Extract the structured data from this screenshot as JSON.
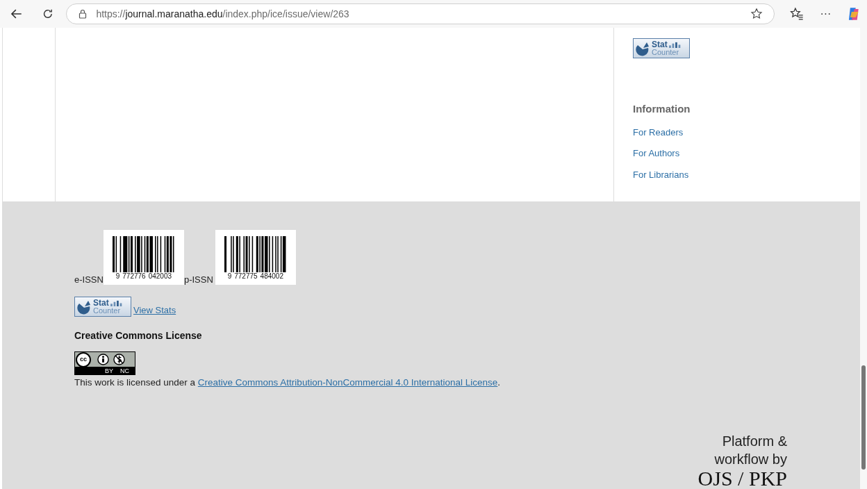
{
  "browser": {
    "url_prefix": "https://",
    "url_host": "journal.maranatha.edu",
    "url_path": "/index.php/ice/issue/view/263",
    "more_label": "···"
  },
  "sidebar": {
    "stat_logo": {
      "line1": "Stat",
      "line2": "Counter"
    },
    "information": {
      "title": "Information",
      "links": [
        "For Readers",
        "For Authors",
        "For Librarians"
      ]
    }
  },
  "footer": {
    "issn": [
      {
        "label": "e-ISSN",
        "digits": [
          "9",
          "772776",
          "042003"
        ]
      },
      {
        "label": "p-ISSN",
        "digits": [
          "9",
          "772775",
          "484002"
        ]
      }
    ],
    "stat_logo": {
      "line1": "Stat",
      "line2": "Counter"
    },
    "view_stats": "View Stats",
    "license_title": "Creative Commons License",
    "cc_badge": {
      "mark": "cc",
      "left": "BY",
      "right": "NC"
    },
    "license_text": "This work is licensed under a ",
    "license_link": "Creative Commons Attribution-NonCommercial 4.0 International License",
    "license_end": ".",
    "platform": {
      "line1": "Platform &",
      "line2": "workflow by",
      "brand": "OJS / PKP"
    }
  }
}
